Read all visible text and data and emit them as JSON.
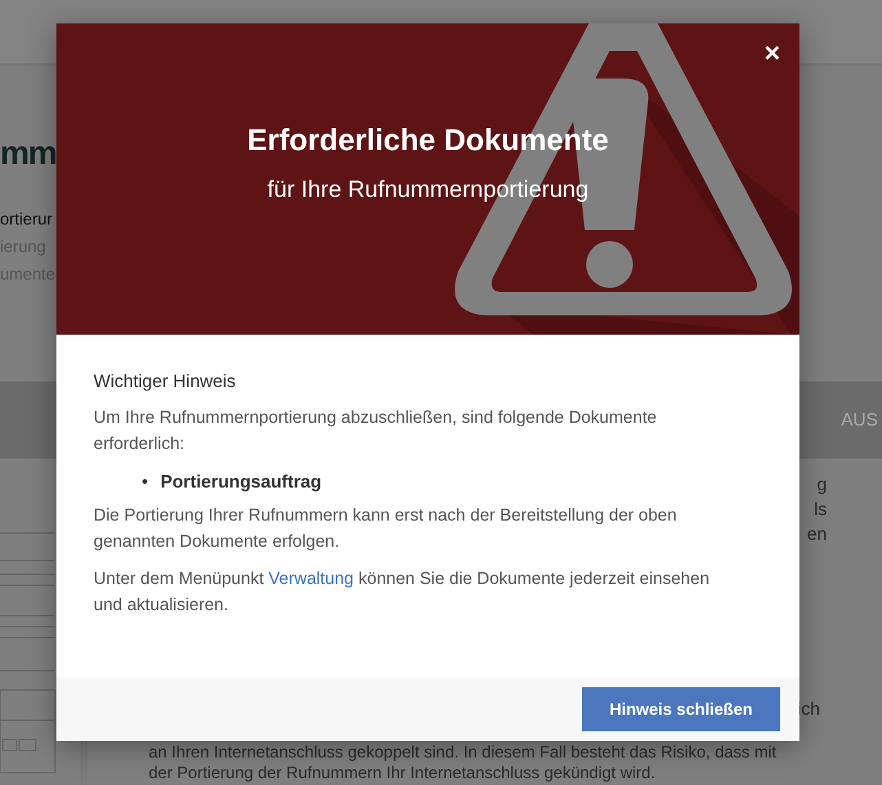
{
  "background": {
    "heading_fragment": "mm",
    "text_fragments": [
      "ortierur",
      "ierung",
      "umente"
    ],
    "nav_fragment": "AUS",
    "right_fragments": [
      "g",
      "ls",
      "en",
      "ich"
    ],
    "paragraph_lines": [
      "an Ihren Internetanschluss gekoppelt sind. In diesem Fall besteht das Risiko, dass mit",
      "der Portierung der Rufnummern Ihr Internetanschluss gekündigt wird."
    ]
  },
  "modal": {
    "title": "Erforderliche Dokumente",
    "subtitle": "für Ihre Rufnummernportierung",
    "close": "×",
    "heading": "Wichtiger Hinweis",
    "intro": "Um Ihre Rufnummernportierung abzuschließen, sind folgende Dokumente erforderlich:",
    "bullet": "•",
    "items": [
      "Portierungsauftrag"
    ],
    "note": "Die Portierung Ihrer Rufnummern kann erst nach der Bereitstellung der oben genannten Dokumente erfolgen.",
    "link_sentence": {
      "before": "Unter dem Menüpunkt ",
      "link": "Verwaltung",
      "after": " können Sie die Dokumente jederzeit einsehen und aktualisieren."
    },
    "button": "Hinweis schließen"
  }
}
